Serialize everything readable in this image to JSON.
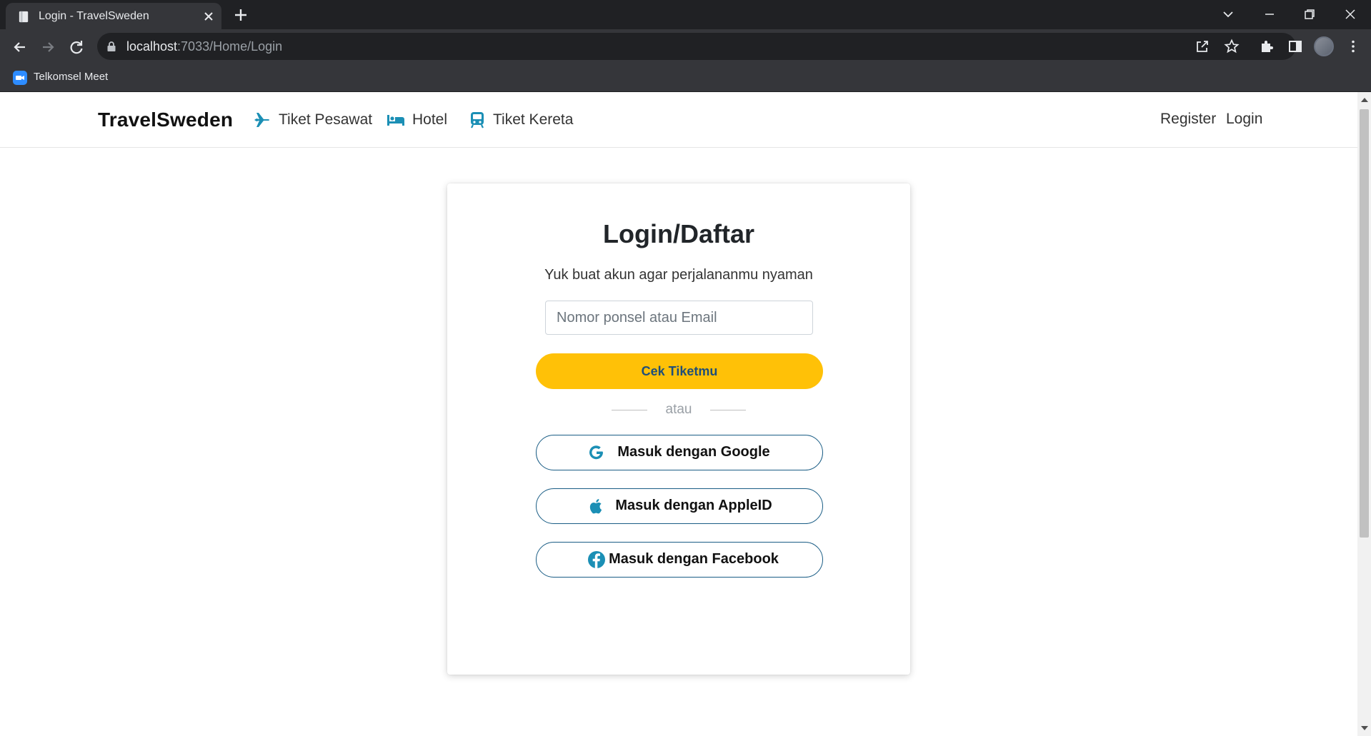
{
  "browser": {
    "tab_title": "Login - TravelSweden",
    "url_host": "localhost",
    "url_path": ":7033/Home/Login",
    "bookmarks": [
      {
        "label": "Telkomsel Meet",
        "icon": "video-camera-icon"
      }
    ]
  },
  "navbar": {
    "brand": "TravelSweden",
    "links": [
      {
        "label": "Tiket Pesawat",
        "icon": "airplane-icon"
      },
      {
        "label": "Hotel",
        "icon": "bed-icon"
      },
      {
        "label": "Tiket Kereta",
        "icon": "train-icon"
      }
    ],
    "right_links": [
      {
        "label": "Register"
      },
      {
        "label": "Login"
      }
    ]
  },
  "login_card": {
    "title": "Login/Daftar",
    "subtitle": "Yuk buat akun agar perjalananmu nyaman",
    "input_placeholder": "Nomor ponsel atau Email",
    "input_value": "",
    "submit_label": "Cek Tiketmu",
    "divider_text": "atau",
    "social_buttons": [
      {
        "label": "Masuk dengan Google",
        "icon": "google-icon"
      },
      {
        "label": "Masuk dengan AppleID",
        "icon": "apple-icon"
      },
      {
        "label": "Masuk dengan Facebook",
        "icon": "facebook-icon"
      }
    ]
  },
  "colors": {
    "accent_yellow": "#ffc107",
    "icon_teal": "#1b8fb5",
    "outline_blue": "#1a5d85"
  }
}
